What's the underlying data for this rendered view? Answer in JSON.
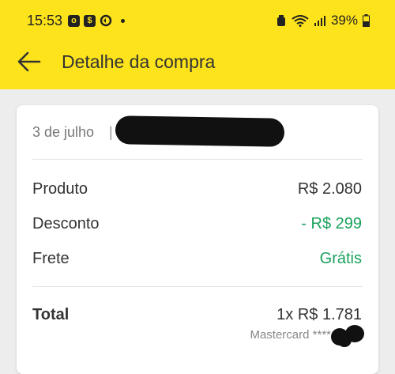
{
  "status_bar": {
    "time": "15:53",
    "battery": "39%",
    "left_icons": [
      "outlook-icon",
      "dollar-icon",
      "sync-icon"
    ],
    "right_icons": [
      "alarm-icon",
      "wifi-icon",
      "signal-icon",
      "battery-icon"
    ]
  },
  "app_bar": {
    "title": "Detalhe da compra",
    "back_icon": "arrow-left-icon",
    "background": "#fde31b"
  },
  "order": {
    "date": "3 de julho",
    "separator": "|"
  },
  "summary": {
    "rows": [
      {
        "label": "Produto",
        "value": "R$ 2.080"
      },
      {
        "label": "Desconto",
        "value": "- R$ 299"
      },
      {
        "label": "Frete",
        "value": "Grátis"
      }
    ],
    "total_label": "Total",
    "total_value": "1x R$ 1.781",
    "payment_method": "Mastercard ****",
    "accent_green": "#1ba25c"
  }
}
